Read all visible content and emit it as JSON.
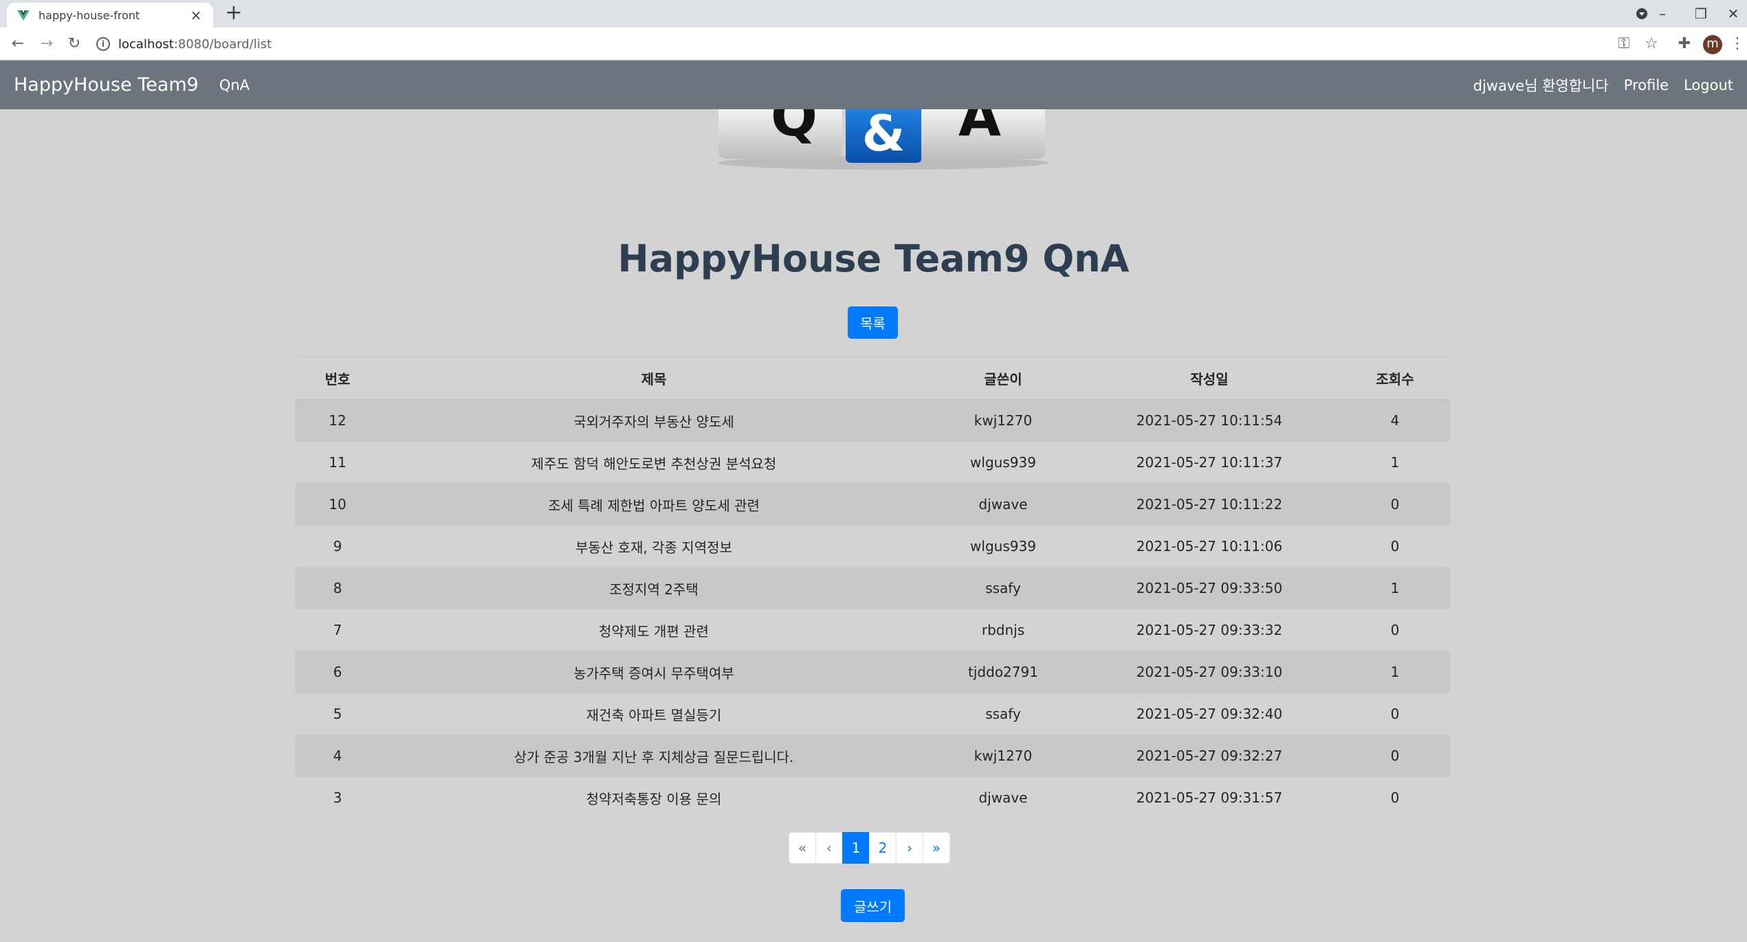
{
  "browser": {
    "tab_title": "happy-house-front",
    "url_host": "localhost",
    "url_path": ":8080/board/list"
  },
  "navbar": {
    "brand": "HappyHouse Team9",
    "qna_link": "QnA",
    "welcome": "djwave님 환영합니다",
    "profile": "Profile",
    "logout": "Logout"
  },
  "page": {
    "title": "HappyHouse Team9 QnA",
    "list_button": "목록",
    "write_button": "글쓰기"
  },
  "banner": {
    "letters": [
      "Q",
      "&",
      "A"
    ]
  },
  "table": {
    "headers": [
      "번호",
      "제목",
      "글쓴이",
      "작성일",
      "조회수"
    ],
    "rows": [
      [
        "12",
        "국외거주자의 부동산 양도세",
        "kwj1270",
        "2021-05-27 10:11:54",
        "4"
      ],
      [
        "11",
        "제주도 함덕 해안도로변 추천상권 분석요청",
        "wlgus939",
        "2021-05-27 10:11:37",
        "1"
      ],
      [
        "10",
        "조세 특례 제한법 아파트 양도세 관련",
        "djwave",
        "2021-05-27 10:11:22",
        "0"
      ],
      [
        "9",
        "부동산 호재, 각종 지역정보",
        "wlgus939",
        "2021-05-27 10:11:06",
        "0"
      ],
      [
        "8",
        "조정지역 2주택",
        "ssafy",
        "2021-05-27 09:33:50",
        "1"
      ],
      [
        "7",
        "청약제도 개편 관련",
        "rbdnjs",
        "2021-05-27 09:33:32",
        "0"
      ],
      [
        "6",
        "농가주택 증여시 무주택여부",
        "tjddo2791",
        "2021-05-27 09:33:10",
        "1"
      ],
      [
        "5",
        "재건축 아파트 멸실등기",
        "ssafy",
        "2021-05-27 09:32:40",
        "0"
      ],
      [
        "4",
        "상가 준공 3개월 지난 후 지체상금 질문드립니다.",
        "kwj1270",
        "2021-05-27 09:32:27",
        "0"
      ],
      [
        "3",
        "청약저축통장 이용 문의",
        "djwave",
        "2021-05-27 09:31:57",
        "0"
      ]
    ]
  },
  "pagination": {
    "first": "«",
    "prev": "‹",
    "pages": [
      "1",
      "2"
    ],
    "active_page": "1",
    "next": "›",
    "last": "»"
  },
  "colors": {
    "navbar": "#6c757d",
    "primary": "#007bff",
    "background": "#d3d3d3",
    "title": "#2c3e50"
  },
  "icons": [
    "vue-logo-icon",
    "close-icon",
    "plus-icon",
    "back-arrow-icon",
    "forward-arrow-icon",
    "reload-icon",
    "info-icon",
    "key-icon",
    "star-icon",
    "puzzle-icon",
    "menu-dots-icon"
  ],
  "profile_initial": "m"
}
